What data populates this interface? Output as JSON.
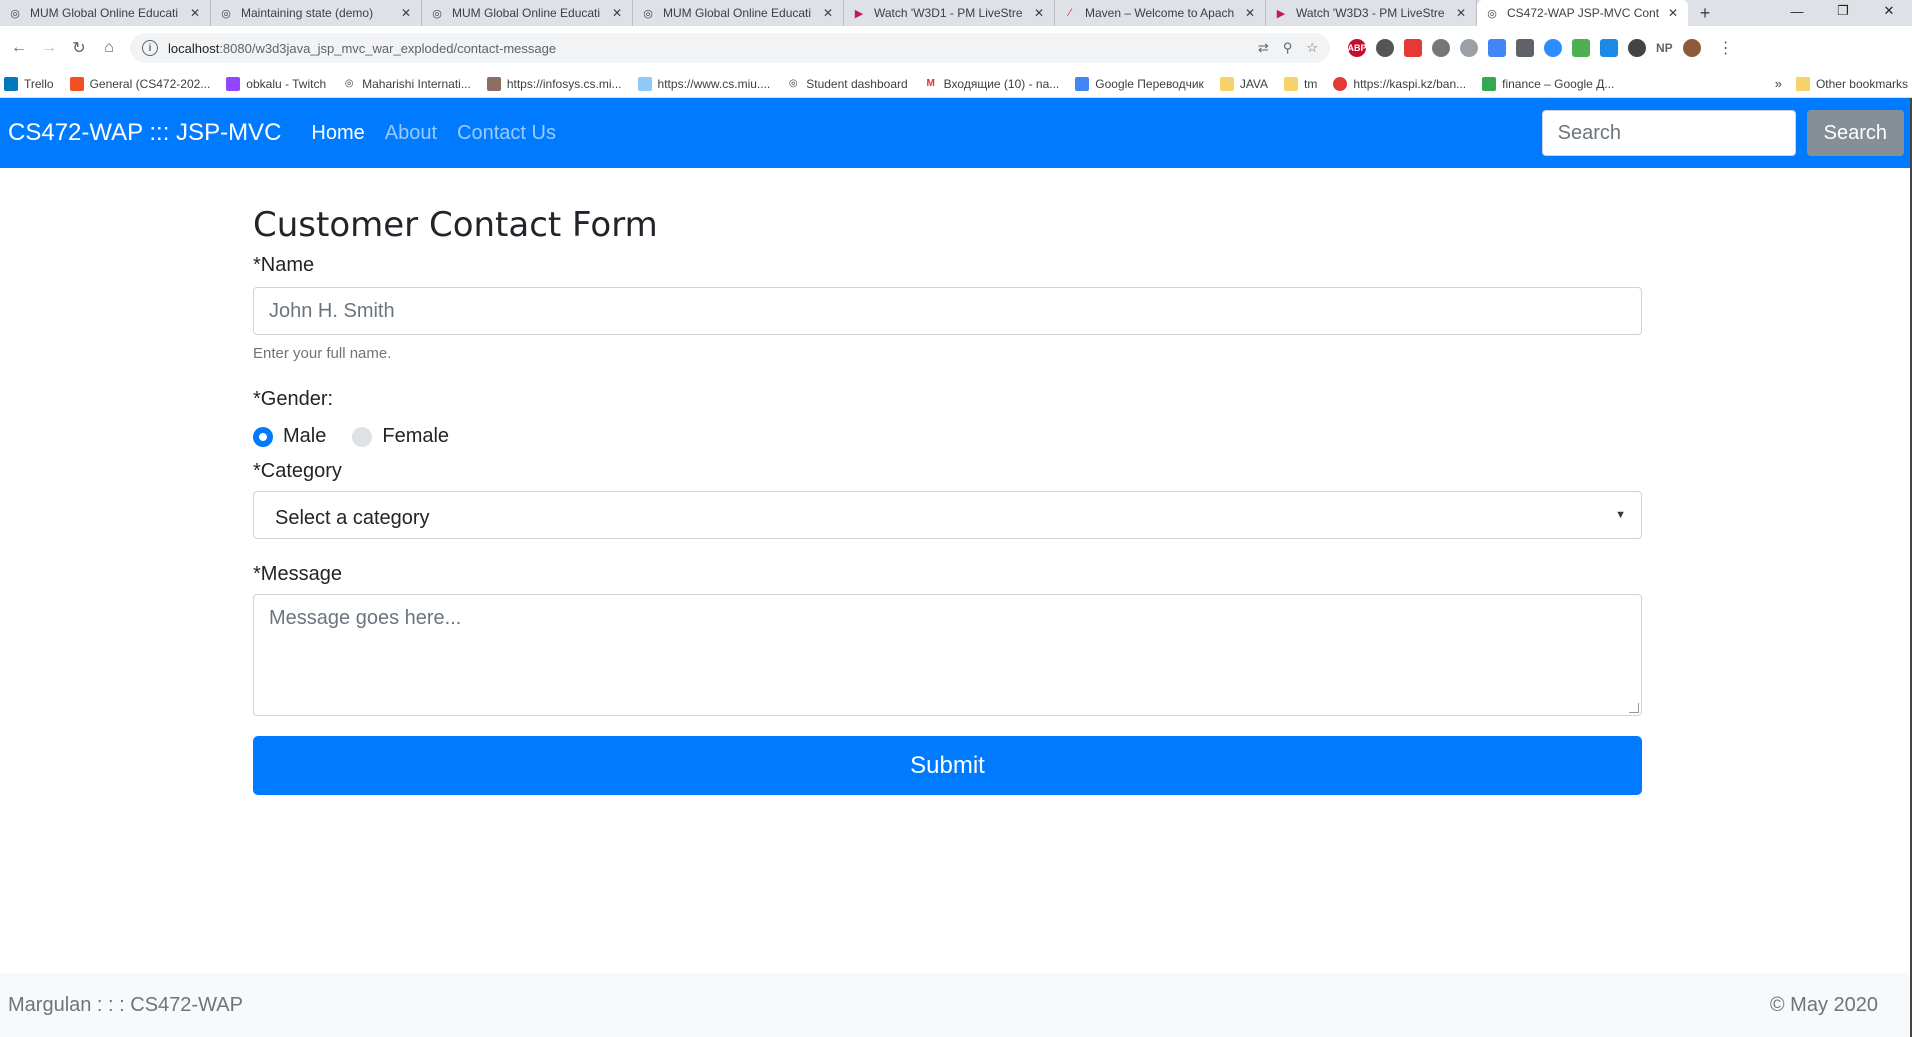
{
  "browser": {
    "tabs": [
      {
        "title": "MUM Global Online Educati",
        "icon": "globe-icon",
        "icon_color": "#5f6368"
      },
      {
        "title": "Maintaining state (demo)",
        "icon": "globe-icon",
        "icon_color": "#5f6368"
      },
      {
        "title": "MUM Global Online Educati",
        "icon": "globe-icon",
        "icon_color": "#5f6368"
      },
      {
        "title": "MUM Global Online Educati",
        "icon": "globe-icon",
        "icon_color": "#5f6368"
      },
      {
        "title": "Watch 'W3D1 - PM LiveStre",
        "icon": "play-icon",
        "icon_color": "#c2185b"
      },
      {
        "title": "Maven – Welcome to Apach",
        "icon": "feather-icon",
        "icon_color": "#d32f2f"
      },
      {
        "title": "Watch 'W3D3 - PM LiveStre",
        "icon": "play-icon",
        "icon_color": "#c2185b"
      },
      {
        "title": "CS472-WAP JSP-MVC Cont",
        "icon": "globe-icon",
        "icon_color": "#5f6368"
      }
    ],
    "active_tab": 7,
    "url_host": "localhost",
    "url_path": ":8080/w3d3java_jsp_mvc_war_exploded/contact-message",
    "extensions": [
      "ABP",
      "NP"
    ],
    "bookmarks": [
      {
        "label": "Trello",
        "icon": "trello-icon",
        "color": "#0079bf"
      },
      {
        "label": "General (CS472-202...",
        "icon": "ms-teams-icon",
        "color": "#f25022"
      },
      {
        "label": "obkalu - Twitch",
        "icon": "twitch-icon",
        "color": "#9146ff"
      },
      {
        "label": "Maharishi Internati...",
        "icon": "globe-icon",
        "color": "#3c4043"
      },
      {
        "label": "https://infosys.cs.mi...",
        "icon": "image-icon",
        "color": "#8d6e63"
      },
      {
        "label": "https://www.cs.miu....",
        "icon": "image-icon",
        "color": "#90caf9"
      },
      {
        "label": "Student dashboard",
        "icon": "globe-icon",
        "color": "#3c4043"
      },
      {
        "label": "Входящие (10) - na...",
        "icon": "gmail-icon",
        "color": "#d93025"
      },
      {
        "label": "Google Переводчик",
        "icon": "translate-icon",
        "color": "#4285f4"
      },
      {
        "label": "JAVA",
        "icon": "folder-icon",
        "color": "#f6d26b"
      },
      {
        "label": "tm",
        "icon": "folder-icon",
        "color": "#f6d26b"
      },
      {
        "label": "https://kaspi.kz/ban...",
        "icon": "kaspi-icon",
        "color": "#e53935"
      },
      {
        "label": "finance – Google Д...",
        "icon": "drive-icon",
        "color": "#34a853"
      }
    ],
    "bookmarks_more": "»",
    "other_bookmarks": "Other bookmarks"
  },
  "navbar": {
    "brand": "CS472-WAP ::: JSP-MVC",
    "links": [
      "Home",
      "About",
      "Contact Us"
    ],
    "active_link": 0,
    "search_placeholder": "Search",
    "search_button": "Search"
  },
  "form": {
    "title": "Customer Contact Form",
    "name_label": "*Name",
    "name_placeholder": "John H. Smith",
    "name_help": "Enter your full name.",
    "gender_label": "*Gender:",
    "gender_options": [
      "Male",
      "Female"
    ],
    "gender_selected": "Male",
    "category_label": "*Category",
    "category_value": "Select a category",
    "message_label": "*Message",
    "message_placeholder": "Message goes here...",
    "submit_label": "Submit"
  },
  "footer": {
    "left": "Margulan : : : CS472-WAP",
    "right": "© May 2020"
  },
  "colors": {
    "primary": "#007bff",
    "secondary": "#868e96",
    "footer_bg": "#f8f9fa"
  }
}
